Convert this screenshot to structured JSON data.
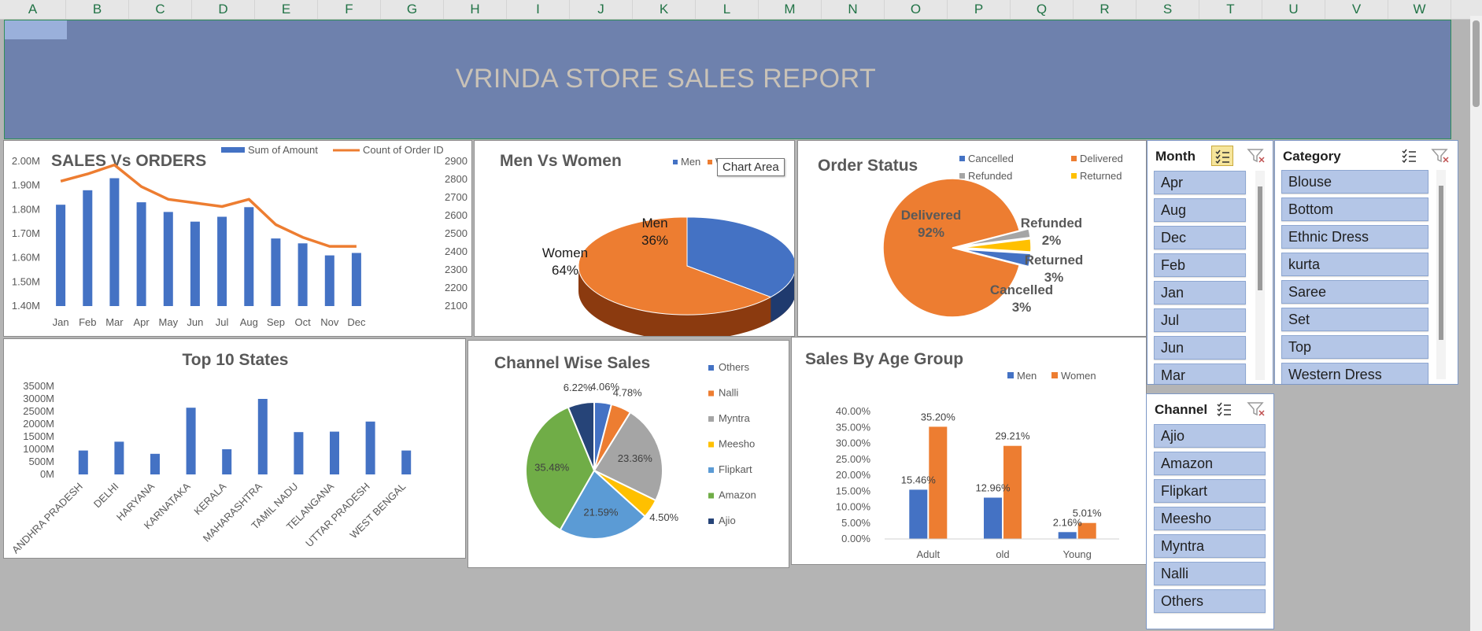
{
  "spreadsheet": {
    "columns": [
      "A",
      "B",
      "C",
      "D",
      "E",
      "F",
      "G",
      "H",
      "I",
      "J",
      "K",
      "L",
      "M",
      "N",
      "O",
      "P",
      "Q",
      "R",
      "S",
      "T",
      "U",
      "V",
      "W"
    ]
  },
  "banner": {
    "title": "VRINDA STORE SALES REPORT"
  },
  "tooltip": "Chart Area",
  "charts": {
    "sales_vs_orders": {
      "title": "SALES Vs ORDERS",
      "legend": [
        "Sum of Amount",
        "Count of Order ID"
      ],
      "left_ticks": [
        "2.00M",
        "1.90M",
        "1.80M",
        "1.70M",
        "1.60M",
        "1.50M",
        "1.40M"
      ],
      "right_ticks": [
        "2900",
        "2800",
        "2700",
        "2600",
        "2500",
        "2400",
        "2300",
        "2200",
        "2100"
      ]
    },
    "men_vs_women": {
      "title": "Men Vs Women",
      "legend": [
        "Men",
        "Wo"
      ],
      "labels": [
        {
          "name": "Men",
          "pct": "36%"
        },
        {
          "name": "Women",
          "pct": "64%"
        }
      ]
    },
    "order_status": {
      "title": "Order Status",
      "legend": [
        "Cancelled",
        "Delivered",
        "Refunded",
        "Returned"
      ],
      "labels": [
        {
          "name": "Delivered",
          "pct": "92%"
        },
        {
          "name": "Refunded",
          "pct": "2%"
        },
        {
          "name": "Returned",
          "pct": "3%"
        },
        {
          "name": "Cancelled",
          "pct": "3%"
        }
      ]
    },
    "top_states": {
      "title": "Top 10 States",
      "ticks": [
        "3500M",
        "3000M",
        "2500M",
        "2000M",
        "1500M",
        "1000M",
        "500M",
        "0M"
      ]
    },
    "channel_sales": {
      "title": "Channel Wise Sales",
      "legend": [
        "Others",
        "Nalli",
        "Myntra",
        "Meesho",
        "Flipkart",
        "Amazon",
        "Ajio"
      ],
      "data_labels": [
        "4.06%",
        "4.78%",
        "23.36%",
        "4.50%",
        "21.59%",
        "35.48%",
        "6.22%"
      ]
    },
    "age_group": {
      "title": "Sales By Age Group",
      "legend": [
        "Men",
        "Women"
      ],
      "ticks": [
        "40.00%",
        "35.00%",
        "30.00%",
        "25.00%",
        "20.00%",
        "15.00%",
        "10.00%",
        "5.00%",
        "0.00%"
      ],
      "data_labels": {
        "men": [
          "15.46%",
          "12.96%",
          "2.16%"
        ],
        "women": [
          "35.20%",
          "29.21%",
          "5.01%"
        ]
      }
    }
  },
  "chart_data": [
    {
      "type": "bar",
      "title": "SALES Vs ORDERS",
      "categories": [
        "Jan",
        "Feb",
        "Mar",
        "Apr",
        "May",
        "Jun",
        "Jul",
        "Aug",
        "Sep",
        "Oct",
        "Nov",
        "Dec"
      ],
      "series": [
        {
          "name": "Sum of Amount",
          "type": "bar",
          "values": [
            1.82,
            1.88,
            1.93,
            1.83,
            1.79,
            1.75,
            1.77,
            1.81,
            1.68,
            1.66,
            1.61,
            1.62
          ]
        },
        {
          "name": "Count of Order ID",
          "type": "line",
          "values": [
            2790,
            2830,
            2880,
            2760,
            2690,
            2670,
            2650,
            2690,
            2550,
            2480,
            2430,
            2430
          ]
        }
      ],
      "ylim": [
        1.4,
        2.0
      ],
      "y2lim": [
        2100,
        2900
      ]
    },
    {
      "type": "pie",
      "title": "Men Vs Women",
      "categories": [
        "Men",
        "Women"
      ],
      "values": [
        36,
        64
      ],
      "colors": [
        "#4472c4",
        "#ed7d31"
      ]
    },
    {
      "type": "pie",
      "title": "Order Status",
      "categories": [
        "Delivered",
        "Refunded",
        "Returned",
        "Cancelled"
      ],
      "values": [
        92,
        2,
        3,
        3
      ],
      "colors": [
        "#ed7d31",
        "#a5a5a5",
        "#ffc000",
        "#4472c4"
      ]
    },
    {
      "type": "bar",
      "title": "Top 10 States",
      "categories": [
        "ANDHRA PRADESH",
        "DELHI",
        "HARYANA",
        "KARNATAKA",
        "KERALA",
        "MAHARASHTRA",
        "TAMIL NADU",
        "TELANGANA",
        "UTTAR PRADESH",
        "WEST BENGAL"
      ],
      "values": [
        950,
        1300,
        820,
        2650,
        1000,
        3000,
        1680,
        1700,
        2100,
        950
      ],
      "ylim": [
        0,
        3500
      ]
    },
    {
      "type": "pie",
      "title": "Channel Wise Sales",
      "categories": [
        "Others",
        "Nalli",
        "Myntra",
        "Meesho",
        "Flipkart",
        "Amazon",
        "Ajio"
      ],
      "values": [
        4.06,
        4.78,
        23.36,
        4.5,
        21.59,
        35.48,
        6.22
      ],
      "colors": [
        "#4472c4",
        "#ed7d31",
        "#a5a5a5",
        "#ffc000",
        "#5b9bd5",
        "#70ad47",
        "#264478"
      ]
    },
    {
      "type": "bar",
      "title": "Sales By Age Group",
      "categories": [
        "Adult",
        "old",
        "Young"
      ],
      "series": [
        {
          "name": "Men",
          "values": [
            15.46,
            12.96,
            2.16
          ]
        },
        {
          "name": "Women",
          "values": [
            35.2,
            29.21,
            5.01
          ]
        }
      ],
      "ylim": [
        0,
        40
      ]
    }
  ],
  "slicers": {
    "month": {
      "title": "Month",
      "items": [
        "Apr",
        "Aug",
        "Dec",
        "Feb",
        "Jan",
        "Jul",
        "Jun",
        "Mar"
      ]
    },
    "category": {
      "title": "Category",
      "items": [
        "Blouse",
        "Bottom",
        "Ethnic Dress",
        "kurta",
        "Saree",
        "Set",
        "Top",
        "Western Dress"
      ]
    },
    "channel": {
      "title": "Channel",
      "items": [
        "Ajio",
        "Amazon",
        "Flipkart",
        "Meesho",
        "Myntra",
        "Nalli",
        "Others"
      ]
    }
  },
  "colors": {
    "blue": "#4472c4",
    "orange": "#ed7d31",
    "banner": "#6e81ad",
    "slicer_item": "#b4c6e7"
  }
}
